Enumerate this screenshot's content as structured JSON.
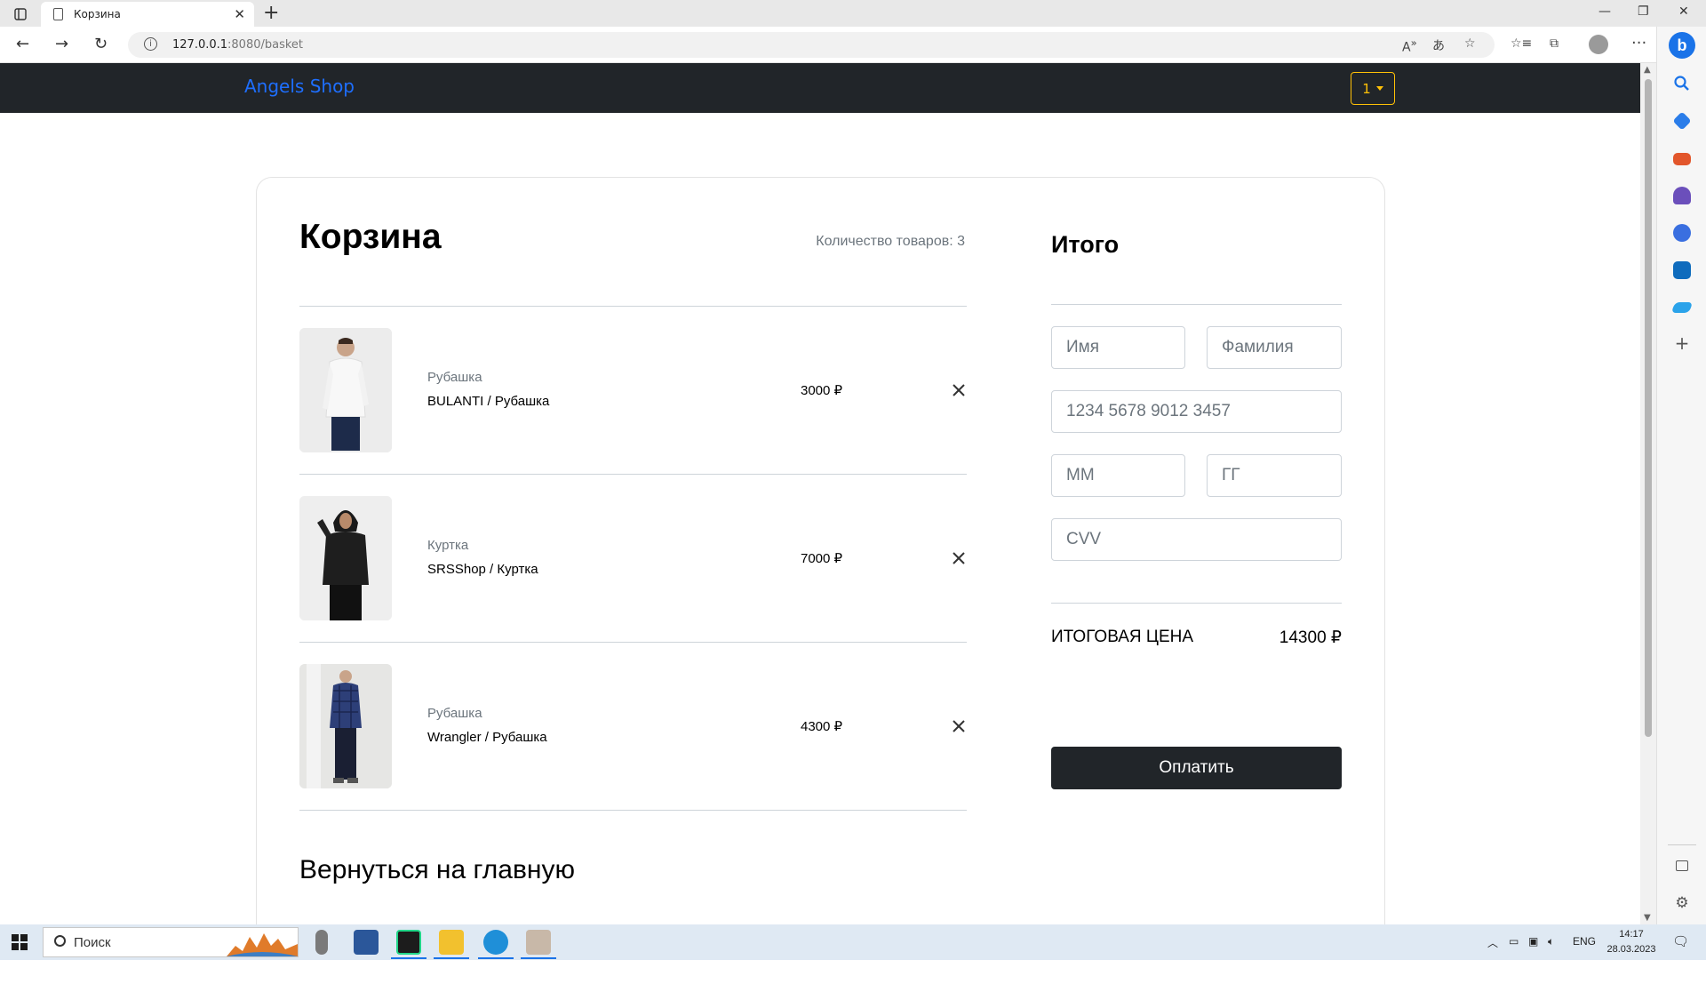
{
  "browser": {
    "tab_title": "Корзина",
    "url_host": "127.0.0.1",
    "url_rest": ":8080/basket"
  },
  "navbar": {
    "brand": "Angels Shop",
    "dropdown_label": "1"
  },
  "cart": {
    "title": "Корзина",
    "count_text": "Количество товаров: 3",
    "items": [
      {
        "category": "Рубашка",
        "name": "BULANTI / Рубашка",
        "price": "3000 ₽"
      },
      {
        "category": "Куртка",
        "name": "SRSShop / Куртка",
        "price": "7000 ₽"
      },
      {
        "category": "Рубашка",
        "name": "Wrangler / Рубашка",
        "price": "4300 ₽"
      }
    ],
    "back_link": "Вернуться на главную"
  },
  "summary": {
    "title": "Итого",
    "first_name_placeholder": "Имя",
    "last_name_placeholder": "Фамилия",
    "card_placeholder": "1234 5678 9012 3457",
    "month_placeholder": "ММ",
    "year_placeholder": "ГГ",
    "cvv_placeholder": "CVV",
    "total_label": "ИТОГОВАЯ ЦЕНА",
    "total_value": "14300 ₽",
    "pay_button": "Оплатить"
  },
  "taskbar": {
    "search_label": "Поиск",
    "lang": "ENG",
    "time": "14:17",
    "date": "28.03.2023"
  },
  "colors": {
    "navbar_bg": "#212529",
    "brand": "#1e6fff",
    "dropdown_accent": "#ffc107",
    "pay_button_bg": "#212529"
  }
}
